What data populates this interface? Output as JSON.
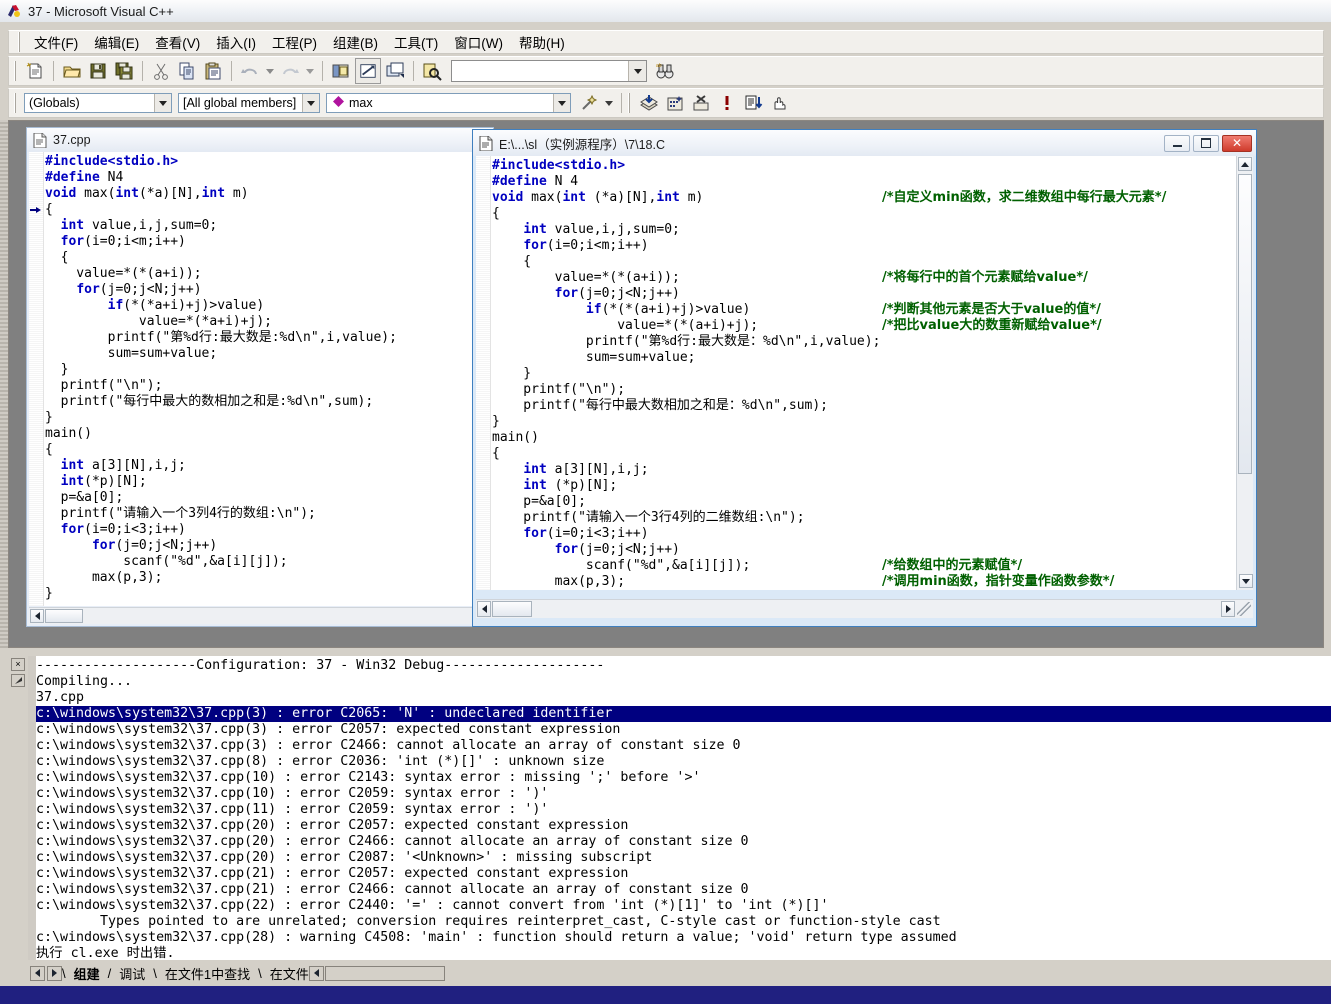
{
  "window": {
    "title": "37 - Microsoft Visual C++",
    "app_icon": "vcpp-icon"
  },
  "menubar": {
    "items": [
      {
        "label": "文件(F)",
        "name": "menu-file"
      },
      {
        "label": "编辑(E)",
        "name": "menu-edit"
      },
      {
        "label": "查看(V)",
        "name": "menu-view"
      },
      {
        "label": "插入(I)",
        "name": "menu-insert"
      },
      {
        "label": "工程(P)",
        "name": "menu-project"
      },
      {
        "label": "组建(B)",
        "name": "menu-build"
      },
      {
        "label": "工具(T)",
        "name": "menu-tools"
      },
      {
        "label": "窗口(W)",
        "name": "menu-window"
      },
      {
        "label": "帮助(H)",
        "name": "menu-help"
      }
    ]
  },
  "toolbar_standard": {
    "buttons": [
      "new-file-icon",
      "open-file-icon",
      "save-icon",
      "save-all-icon",
      "cut-icon",
      "copy-icon",
      "paste-icon",
      "undo-icon",
      "undo-dropdown-icon",
      "redo-icon",
      "redo-dropdown-icon",
      "workspace-icon",
      "output-window-icon",
      "window-list-icon",
      "find-in-files-icon"
    ],
    "find_box_value": "",
    "find_box_placeholder": "",
    "find_next_icon": "binoculars-icon"
  },
  "toolbar_wizardbar": {
    "globals_value": "(Globals)",
    "members_value": "[All global members]",
    "symbol_value": "max",
    "symbol_icon": "member-diamond-icon",
    "actions_icon": "wizard-wand-icon",
    "build_buttons": [
      "compile-icon",
      "build-icon",
      "stop-build-icon",
      "insert-breakpoint-icon",
      "go-icon",
      "hand-icon"
    ]
  },
  "editor_left": {
    "title": "37.cpp",
    "icon": "cpp-document-icon",
    "current_line_marker": true,
    "lines": [
      [
        {
          "t": "#include<stdio.h>",
          "c": "pp"
        }
      ],
      [
        {
          "t": "#define",
          "c": "pp"
        },
        {
          "t": " N4",
          "c": "plain"
        }
      ],
      [
        {
          "t": "void",
          "c": "kw"
        },
        {
          "t": " max(",
          "c": "plain"
        },
        {
          "t": "int",
          "c": "kw"
        },
        {
          "t": "(*a)[N],",
          "c": "plain"
        },
        {
          "t": "int",
          "c": "kw"
        },
        {
          "t": " m)",
          "c": "plain"
        }
      ],
      [
        {
          "t": "{",
          "c": "plain"
        }
      ],
      [
        {
          "t": "  ",
          "c": "plain"
        },
        {
          "t": "int",
          "c": "kw"
        },
        {
          "t": " value,i,j,sum=0;",
          "c": "plain"
        }
      ],
      [
        {
          "t": "  ",
          "c": "plain"
        },
        {
          "t": "for",
          "c": "kw"
        },
        {
          "t": "(i=0;i<m;i++)",
          "c": "plain"
        }
      ],
      [
        {
          "t": "  {",
          "c": "plain"
        }
      ],
      [
        {
          "t": "    value=*(*(a+i));",
          "c": "plain"
        }
      ],
      [
        {
          "t": "    ",
          "c": "plain"
        },
        {
          "t": "for",
          "c": "kw"
        },
        {
          "t": "(j=0;j<N;j++)",
          "c": "plain"
        }
      ],
      [
        {
          "t": "        ",
          "c": "plain"
        },
        {
          "t": "if",
          "c": "kw"
        },
        {
          "t": "(*(*a+i)+j)>value)",
          "c": "plain"
        }
      ],
      [
        {
          "t": "            value=*(*a+i)+j);",
          "c": "plain"
        }
      ],
      [
        {
          "t": "        printf(\"第%d行:最大数是:%d\\n\",i,value);",
          "c": "plain"
        }
      ],
      [
        {
          "t": "        sum=sum+value;",
          "c": "plain"
        }
      ],
      [
        {
          "t": "  }",
          "c": "plain"
        }
      ],
      [
        {
          "t": "  printf(\"\\n\");",
          "c": "plain"
        }
      ],
      [
        {
          "t": "  printf(\"每行中最大的数相加之和是:%d\\n\",sum);",
          "c": "plain"
        }
      ],
      [
        {
          "t": "}",
          "c": "plain"
        }
      ],
      [
        {
          "t": "main()",
          "c": "plain"
        }
      ],
      [
        {
          "t": "{",
          "c": "plain"
        }
      ],
      [
        {
          "t": "  ",
          "c": "plain"
        },
        {
          "t": "int",
          "c": "kw"
        },
        {
          "t": " a[3][N],i,j;",
          "c": "plain"
        }
      ],
      [
        {
          "t": "  ",
          "c": "plain"
        },
        {
          "t": "int",
          "c": "kw"
        },
        {
          "t": "(*p)[N];",
          "c": "plain"
        }
      ],
      [
        {
          "t": "  p=&a[0];",
          "c": "plain"
        }
      ],
      [
        {
          "t": "  printf(\"请输入一个3列4行的数组:\\n\");",
          "c": "plain"
        }
      ],
      [
        {
          "t": "  ",
          "c": "plain"
        },
        {
          "t": "for",
          "c": "kw"
        },
        {
          "t": "(i=0;i<3;i++)",
          "c": "plain"
        }
      ],
      [
        {
          "t": "      ",
          "c": "plain"
        },
        {
          "t": "for",
          "c": "kw"
        },
        {
          "t": "(j=0;j<N;j++)",
          "c": "plain"
        }
      ],
      [
        {
          "t": "          scanf(\"%d\",&a[i][j]);",
          "c": "plain"
        }
      ],
      [
        {
          "t": "      max(p,3);",
          "c": "plain"
        }
      ],
      [
        {
          "t": "}",
          "c": "plain"
        }
      ]
    ]
  },
  "editor_right": {
    "title": "E:\\...\\sl（实例源程序）\\7\\18.C",
    "icon": "c-document-icon",
    "buttons": {
      "minimize": "minimize-icon",
      "maximize": "maximize-icon",
      "close": "close-icon"
    },
    "lines": [
      {
        "code": [
          {
            "t": "#include<stdio.h>",
            "c": "pp"
          }
        ],
        "comment": ""
      },
      {
        "code": [
          {
            "t": "#define",
            "c": "pp"
          },
          {
            "t": " N 4",
            "c": "plain"
          }
        ],
        "comment": ""
      },
      {
        "code": [
          {
            "t": "void",
            "c": "kw"
          },
          {
            "t": " max(",
            "c": "plain"
          },
          {
            "t": "int",
            "c": "kw"
          },
          {
            "t": " (*a)[N],",
            "c": "plain"
          },
          {
            "t": "int",
            "c": "kw"
          },
          {
            "t": " m)",
            "c": "plain"
          }
        ],
        "comment": "/*自定义min函数，求二维数组中每行最大元素*/"
      },
      {
        "code": [
          {
            "t": "{",
            "c": "plain"
          }
        ],
        "comment": ""
      },
      {
        "code": [
          {
            "t": "    ",
            "c": "plain"
          },
          {
            "t": "int",
            "c": "kw"
          },
          {
            "t": " value,i,j,sum=0;",
            "c": "plain"
          }
        ],
        "comment": ""
      },
      {
        "code": [
          {
            "t": "    ",
            "c": "plain"
          },
          {
            "t": "for",
            "c": "kw"
          },
          {
            "t": "(i=0;i<m;i++)",
            "c": "plain"
          }
        ],
        "comment": ""
      },
      {
        "code": [
          {
            "t": "    {",
            "c": "plain"
          }
        ],
        "comment": ""
      },
      {
        "code": [
          {
            "t": "        value=*(*(a+i));",
            "c": "plain"
          }
        ],
        "comment": "/*将每行中的首个元素赋给value*/"
      },
      {
        "code": [
          {
            "t": "        ",
            "c": "plain"
          },
          {
            "t": "for",
            "c": "kw"
          },
          {
            "t": "(j=0;j<N;j++)",
            "c": "plain"
          }
        ],
        "comment": ""
      },
      {
        "code": [
          {
            "t": "            ",
            "c": "plain"
          },
          {
            "t": "if",
            "c": "kw"
          },
          {
            "t": "(*(*(a+i)+j)>value)",
            "c": "plain"
          }
        ],
        "comment": "/*判断其他元素是否大于value的值*/"
      },
      {
        "code": [
          {
            "t": "                value=*(*(a+i)+j);",
            "c": "plain"
          }
        ],
        "comment": "/*把比value大的数重新赋给value*/"
      },
      {
        "code": [
          {
            "t": "            printf(\"第%d行:最大数是：%d\\n\",i,value);",
            "c": "plain"
          }
        ],
        "comment": ""
      },
      {
        "code": [
          {
            "t": "            sum=sum+value;",
            "c": "plain"
          }
        ],
        "comment": ""
      },
      {
        "code": [
          {
            "t": "    }",
            "c": "plain"
          }
        ],
        "comment": ""
      },
      {
        "code": [
          {
            "t": "    printf(\"\\n\");",
            "c": "plain"
          }
        ],
        "comment": ""
      },
      {
        "code": [
          {
            "t": "    printf(\"每行中最大数相加之和是：%d\\n\",sum);",
            "c": "plain"
          }
        ],
        "comment": ""
      },
      {
        "code": [
          {
            "t": "}",
            "c": "plain"
          }
        ],
        "comment": ""
      },
      {
        "code": [
          {
            "t": "main()",
            "c": "plain"
          }
        ],
        "comment": ""
      },
      {
        "code": [
          {
            "t": "{",
            "c": "plain"
          }
        ],
        "comment": ""
      },
      {
        "code": [
          {
            "t": "    ",
            "c": "plain"
          },
          {
            "t": "int",
            "c": "kw"
          },
          {
            "t": " a[3][N],i,j;",
            "c": "plain"
          }
        ],
        "comment": ""
      },
      {
        "code": [
          {
            "t": "    ",
            "c": "plain"
          },
          {
            "t": "int",
            "c": "kw"
          },
          {
            "t": " (*p)[N];",
            "c": "plain"
          }
        ],
        "comment": ""
      },
      {
        "code": [
          {
            "t": "    p=&a[0];",
            "c": "plain"
          }
        ],
        "comment": ""
      },
      {
        "code": [
          {
            "t": "    printf(\"请输入一个3行4列的二维数组:\\n\");",
            "c": "plain"
          }
        ],
        "comment": ""
      },
      {
        "code": [
          {
            "t": "    ",
            "c": "plain"
          },
          {
            "t": "for",
            "c": "kw"
          },
          {
            "t": "(i=0;i<3;i++)",
            "c": "plain"
          }
        ],
        "comment": ""
      },
      {
        "code": [
          {
            "t": "        ",
            "c": "plain"
          },
          {
            "t": "for",
            "c": "kw"
          },
          {
            "t": "(j=0;j<N;j++)",
            "c": "plain"
          }
        ],
        "comment": ""
      },
      {
        "code": [
          {
            "t": "            scanf(\"%d\",&a[i][j]);",
            "c": "plain"
          }
        ],
        "comment": "/*给数组中的元素赋值*/"
      },
      {
        "code": [
          {
            "t": "        max(p,3);",
            "c": "plain"
          }
        ],
        "comment": "/*调用min函数，指针变量作函数参数*/"
      },
      {
        "code": [
          {
            "t": "}",
            "c": "plain"
          }
        ],
        "comment": ""
      }
    ]
  },
  "output": {
    "close_glyph": "×",
    "dock_glyph": "dock-icon",
    "lines": [
      {
        "text": "--------------------Configuration: 37 - Win32 Debug--------------------",
        "selected": false
      },
      {
        "text": "Compiling...",
        "selected": false
      },
      {
        "text": "37.cpp",
        "selected": false
      },
      {
        "text": "c:\\windows\\system32\\37.cpp(3) : error C2065: 'N' : undeclared identifier",
        "selected": true
      },
      {
        "text": "c:\\windows\\system32\\37.cpp(3) : error C2057: expected constant expression",
        "selected": false
      },
      {
        "text": "c:\\windows\\system32\\37.cpp(3) : error C2466: cannot allocate an array of constant size 0",
        "selected": false
      },
      {
        "text": "c:\\windows\\system32\\37.cpp(8) : error C2036: 'int (*)[]' : unknown size",
        "selected": false
      },
      {
        "text": "c:\\windows\\system32\\37.cpp(10) : error C2143: syntax error : missing ';' before '>'",
        "selected": false
      },
      {
        "text": "c:\\windows\\system32\\37.cpp(10) : error C2059: syntax error : ')'",
        "selected": false
      },
      {
        "text": "c:\\windows\\system32\\37.cpp(11) : error C2059: syntax error : ')'",
        "selected": false
      },
      {
        "text": "c:\\windows\\system32\\37.cpp(20) : error C2057: expected constant expression",
        "selected": false
      },
      {
        "text": "c:\\windows\\system32\\37.cpp(20) : error C2466: cannot allocate an array of constant size 0",
        "selected": false
      },
      {
        "text": "c:\\windows\\system32\\37.cpp(20) : error C2087: '<Unknown>' : missing subscript",
        "selected": false
      },
      {
        "text": "c:\\windows\\system32\\37.cpp(21) : error C2057: expected constant expression",
        "selected": false
      },
      {
        "text": "c:\\windows\\system32\\37.cpp(21) : error C2466: cannot allocate an array of constant size 0",
        "selected": false
      },
      {
        "text": "c:\\windows\\system32\\37.cpp(22) : error C2440: '=' : cannot convert from 'int (*)[1]' to 'int (*)[]'",
        "selected": false
      },
      {
        "text": "        Types pointed to are unrelated; conversion requires reinterpret_cast, C-style cast or function-style cast",
        "selected": false
      },
      {
        "text": "c:\\windows\\system32\\37.cpp(28) : warning C4508: 'main' : function should return a value; 'void' return type assumed",
        "selected": false
      },
      {
        "text": "执行 cl.exe 时出错.",
        "selected": false
      }
    ],
    "tabs": [
      {
        "label": "组建",
        "active": true,
        "name": "tab-build"
      },
      {
        "label": "调试",
        "active": false,
        "name": "tab-debug"
      },
      {
        "label": "在文件1中查找",
        "active": false,
        "name": "tab-find-in-files-1"
      },
      {
        "label": "在文件",
        "active": false,
        "name": "tab-find-in-files-2"
      }
    ]
  },
  "colors": {
    "keyword": "#0000c0",
    "comment": "#006000",
    "selection": "#000080",
    "window_face": "#d4d0c8",
    "mdi_background": "#808080"
  }
}
